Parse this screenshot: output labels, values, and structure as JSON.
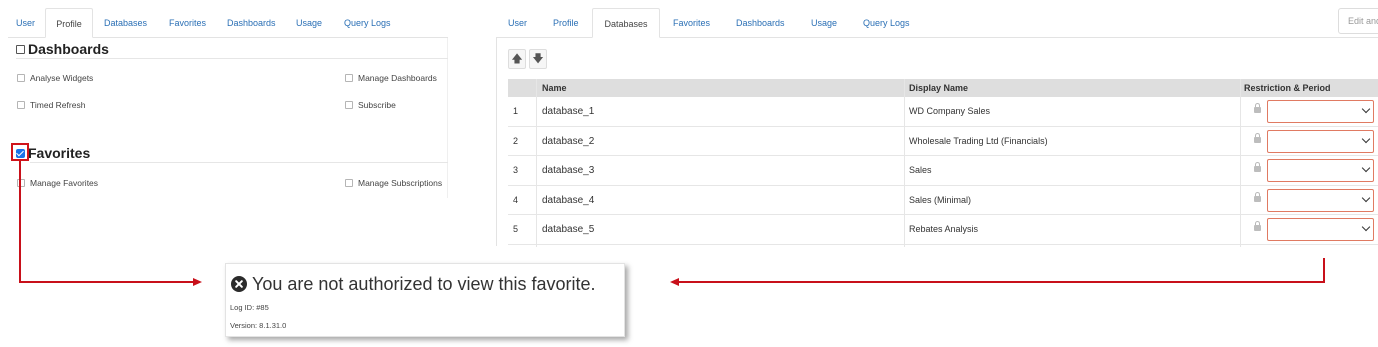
{
  "left_tabs": [
    "User",
    "Profile",
    "Databases",
    "Favorites",
    "Dashboards",
    "Usage",
    "Query Logs"
  ],
  "left_active_tab": "Profile",
  "dashboards_section": {
    "title": "Dashboards",
    "checked": false,
    "permissions": [
      "Analyse Widgets",
      "Manage Dashboards",
      "Timed Refresh",
      "Subscribe"
    ]
  },
  "favorites_section": {
    "title": "Favorites",
    "checked": true,
    "permissions": [
      "Manage Favorites",
      "Manage Subscriptions"
    ]
  },
  "right_tabs": [
    "User",
    "Profile",
    "Databases",
    "Favorites",
    "Dashboards",
    "Usage",
    "Query Logs"
  ],
  "right_active_tab": "Databases",
  "edit_button_label": "Edit and",
  "move_up_icon": "arrow-up-icon",
  "move_down_icon": "arrow-down-icon",
  "grid": {
    "columns": [
      "Name",
      "Display Name",
      "Restriction & Period"
    ],
    "rows": [
      {
        "num": "1",
        "name": "database_1",
        "display": "WD Company Sales"
      },
      {
        "num": "2",
        "name": "database_2",
        "display": "Wholesale Trading Ltd (Financials)"
      },
      {
        "num": "3",
        "name": "database_3",
        "display": "Sales"
      },
      {
        "num": "4",
        "name": "database_4",
        "display": "Sales (Minimal)"
      },
      {
        "num": "5",
        "name": "database_5",
        "display": "Rebates Analysis"
      }
    ]
  },
  "error": {
    "icon": "error-circle-x-icon",
    "message": "You are not authorized to view this favorite.",
    "log_id": "Log ID: #85",
    "version": "Version: 8.1.31.0"
  },
  "colors": {
    "accent_link": "#2a6fb5",
    "annotation_red": "#c8101a",
    "select_border": "#e07a62",
    "checkbox_blue": "#1a73e8"
  }
}
